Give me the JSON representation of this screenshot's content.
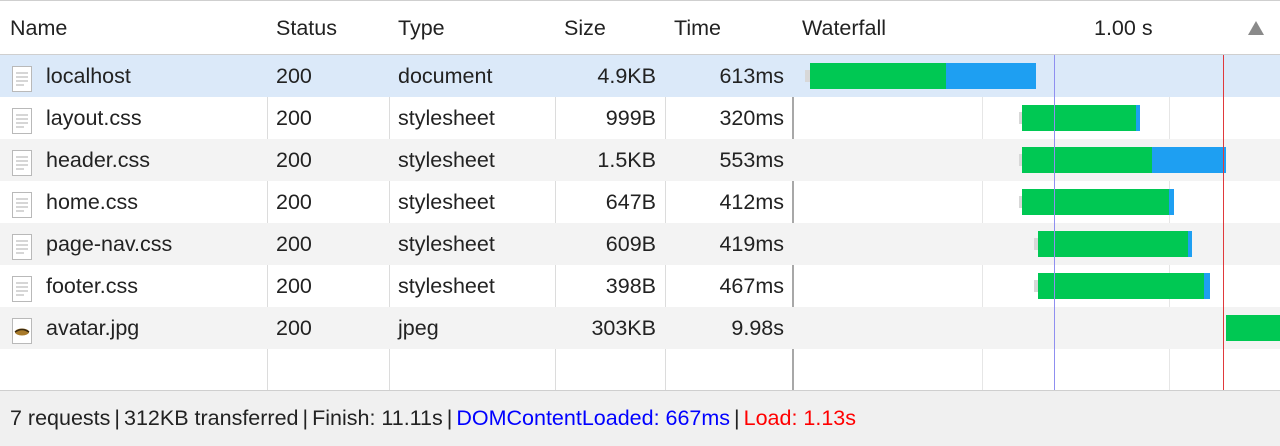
{
  "columns": {
    "name": "Name",
    "status": "Status",
    "type": "Type",
    "size": "Size",
    "time": "Time",
    "waterfall": "Waterfall",
    "scale_label": "1.00 s"
  },
  "rows": [
    {
      "name": "localhost",
      "status": "200",
      "type": "document",
      "size": "4.9KB",
      "time": "613ms",
      "icon": "document-icon"
    },
    {
      "name": "layout.css",
      "status": "200",
      "type": "stylesheet",
      "size": "999B",
      "time": "320ms",
      "icon": "document-icon"
    },
    {
      "name": "header.css",
      "status": "200",
      "type": "stylesheet",
      "size": "1.5KB",
      "time": "553ms",
      "icon": "document-icon"
    },
    {
      "name": "home.css",
      "status": "200",
      "type": "stylesheet",
      "size": "647B",
      "time": "412ms",
      "icon": "document-icon"
    },
    {
      "name": "page-nav.css",
      "status": "200",
      "type": "stylesheet",
      "size": "609B",
      "time": "419ms",
      "icon": "document-icon"
    },
    {
      "name": "footer.css",
      "status": "200",
      "type": "stylesheet",
      "size": "398B",
      "time": "467ms",
      "icon": "document-icon"
    },
    {
      "name": "avatar.jpg",
      "status": "200",
      "type": "jpeg",
      "size": "303KB",
      "time": "9.98s",
      "icon": "image-thumbnail-icon"
    }
  ],
  "status_bar": {
    "requests": "7 requests",
    "transferred": "312KB transferred",
    "finish": "Finish: 11.11s",
    "dom_content_loaded": "DOMContentLoaded: 667ms",
    "load": "Load: 1.13s"
  },
  "colors": {
    "waiting": "#00c853",
    "download": "#1e9ff2",
    "dom_line": "#8f8ff0",
    "load_line": "#e0393b",
    "dcl_text": "#0000ff",
    "load_text": "#ff0000",
    "selected_row": "#dbe9f9"
  }
}
